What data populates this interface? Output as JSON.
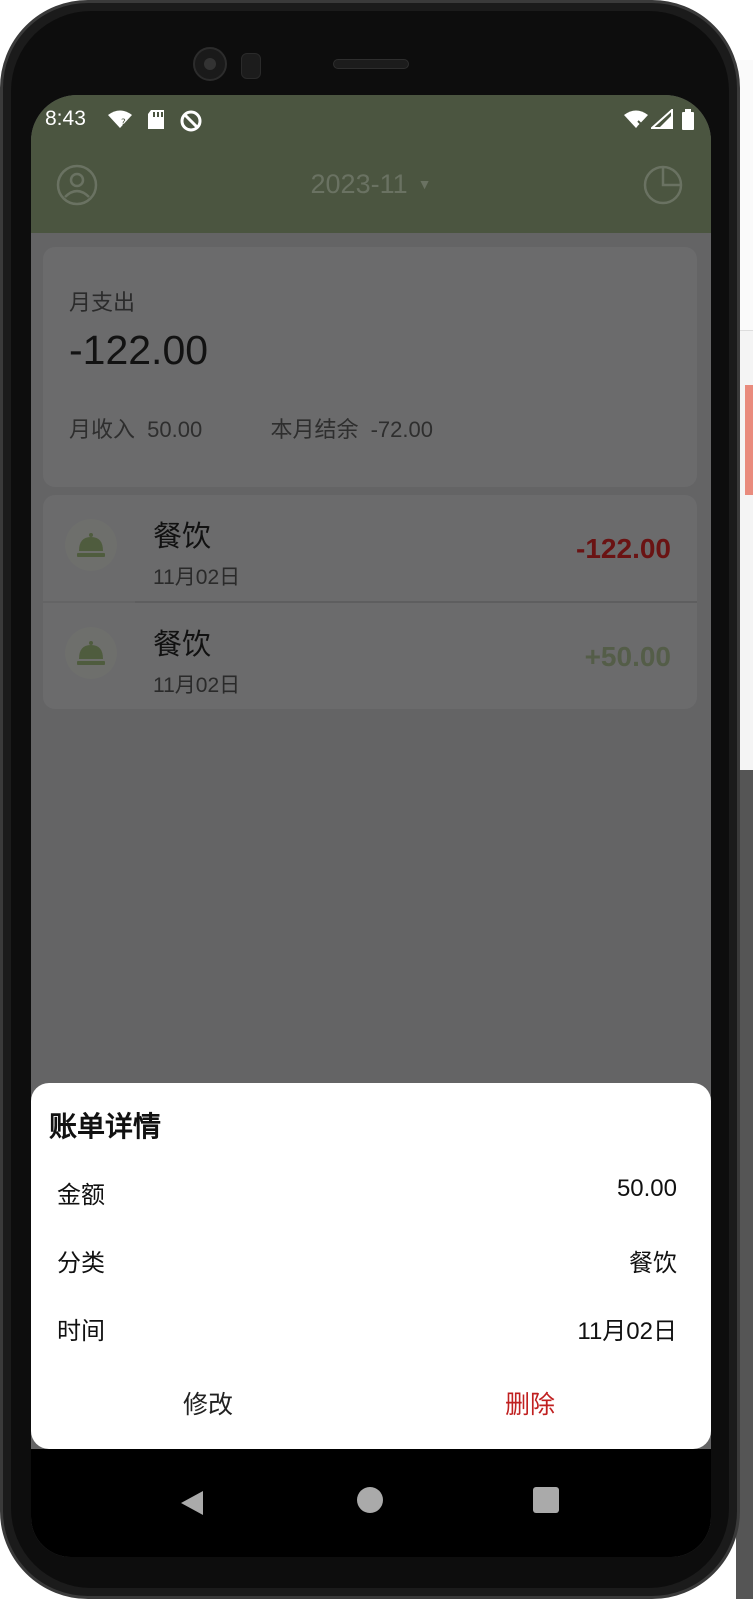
{
  "status": {
    "time": "8:43"
  },
  "appbar": {
    "month": "2023-11",
    "profile_icon": "user-circle-icon",
    "chart_icon": "pie-chart-icon",
    "caret_icon": "dropdown-caret-icon"
  },
  "summary": {
    "expense_label": "月支出",
    "expense_amount": "-122.00",
    "income_label": "月收入",
    "income_amount": "50.00",
    "balance_label": "本月结余",
    "balance_amount": "-72.00"
  },
  "bills": [
    {
      "category": "餐饮",
      "date": "11月02日",
      "amount": "-122.00",
      "type": "expense",
      "icon": "food-cloche-icon"
    },
    {
      "category": "餐饮",
      "date": "11月02日",
      "amount": "+50.00",
      "type": "income",
      "icon": "food-cloche-icon"
    }
  ],
  "sheet": {
    "title": "账单详情",
    "rows": [
      {
        "key": "金额",
        "value": "50.00"
      },
      {
        "key": "分类",
        "value": "餐饮"
      },
      {
        "key": "时间",
        "value": "11月02日"
      }
    ],
    "edit_label": "修改",
    "delete_label": "删除"
  },
  "colors": {
    "header_green": "#4b5540",
    "expense_red": "#6a1313",
    "income_green": "#545d48",
    "delete_red": "#c02020"
  }
}
